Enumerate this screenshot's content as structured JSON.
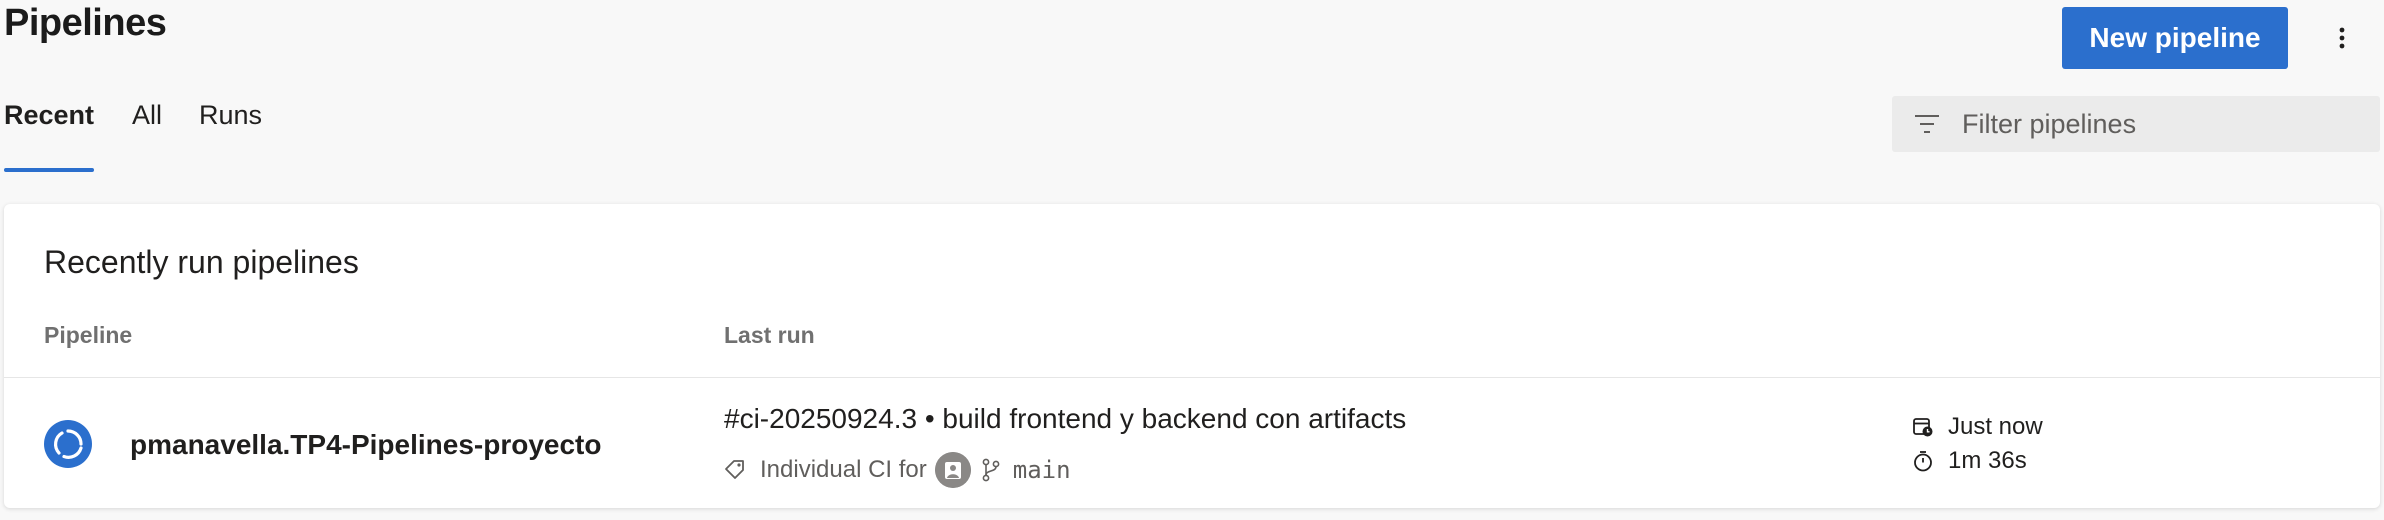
{
  "header": {
    "title": "Pipelines",
    "new_pipeline_label": "New pipeline",
    "more_icon": "more-vertical-icon"
  },
  "tabs": [
    {
      "label": "Recent",
      "active": true
    },
    {
      "label": "All",
      "active": false
    },
    {
      "label": "Runs",
      "active": false
    }
  ],
  "filter": {
    "placeholder": "Filter pipelines",
    "icon": "filter-icon"
  },
  "recent": {
    "title": "Recently run pipelines",
    "columns": {
      "pipeline": "Pipeline",
      "last_run": "Last run"
    },
    "rows": [
      {
        "status_icon": "in-progress-icon",
        "name": "pmanavella.TP4-Pipelines-proyecto",
        "run_title": "#ci-20250924.3 • build frontend y backend con artifacts",
        "trigger": "Individual CI for",
        "branch": "main",
        "started": "Just now",
        "duration": "1m 36s"
      }
    ]
  },
  "colors": {
    "accent": "#2b6fcd",
    "background": "#f8f8f8",
    "card": "#ffffff"
  }
}
